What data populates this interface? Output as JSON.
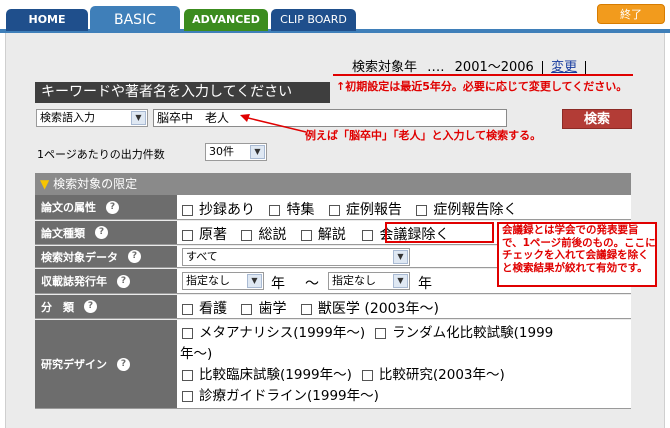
{
  "tabs": {
    "home": "HOME",
    "basic": "BASIC",
    "advanced": "ADVANCED",
    "clipboard": "CLIP BOARD",
    "exit": "終了"
  },
  "year": {
    "label": "検索対象年",
    "dots": "‥‥",
    "range": "2001～2006",
    "change": "変更"
  },
  "notes": {
    "year_note": "↑初期設定は最近5年分。必要に応じて変更してください。",
    "keyword_note": "例えば「脳卒中」「老人」と入力して検索する。",
    "conference_note": "会議録とは学会での発表要旨で、1ページ前後のもの。ここにチェックを入れて会議録を除くと検索結果が絞れて有効です。"
  },
  "keyword": {
    "header": "キーワードや著者名を入力してください",
    "field_type": "検索語入力",
    "value": "脳卒中　老人",
    "search_button": "検索"
  },
  "perpage": {
    "label": "1ページあたりの出力件数",
    "value": "30件"
  },
  "criteria": {
    "header": "検索対象の限定",
    "rows": {
      "attributes": {
        "label": "論文の属性",
        "options": [
          "抄録あり",
          "特集",
          "症例報告",
          "症例報告除く"
        ]
      },
      "types": {
        "label": "論文種類",
        "options": [
          "原著",
          "総説",
          "解説",
          "会議録除く"
        ]
      },
      "target_data": {
        "label": "検索対象データ",
        "value": "すべて"
      },
      "pub_year": {
        "label": "収載誌発行年",
        "from": "指定なし",
        "year1": "年",
        "tilde": "～",
        "to": "指定なし",
        "year2": "年"
      },
      "category": {
        "label": "分　類",
        "options": [
          "看護",
          "歯学",
          "獣医学 (2003年～)"
        ]
      },
      "design": {
        "label": "研究デザイン",
        "opt1": "メタアナリシス(1999年～)",
        "opt2": "ランダム化比較試験(1999",
        "opt2_cont": "年～)",
        "opt3": "比較臨床試験(1999年～)",
        "opt4": "比較研究(2003年～)",
        "opt5": "診療ガイドライン(1999年～)"
      }
    }
  },
  "colors": {
    "tab_blue": "#3f7fb9",
    "tab_dark": "#1f4f8c",
    "tab_green": "#3c8c1f",
    "exit_orange": "#f29b1d",
    "search_red": "#b33c36",
    "annotation_red": "#e00000"
  },
  "icons": [
    "help-icon",
    "dropdown-arrow-icon",
    "triangle-icon",
    "arrow-icon"
  ]
}
